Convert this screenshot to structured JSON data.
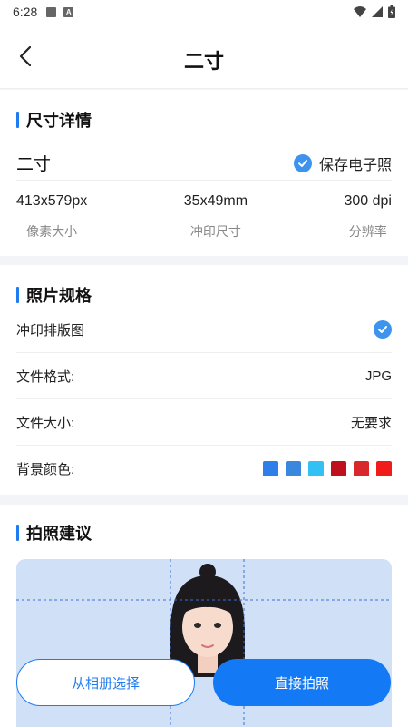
{
  "status_bar": {
    "time": "6:28"
  },
  "nav": {
    "title": "二寸"
  },
  "size_details": {
    "section_title": "尺寸详情",
    "size_name": "二寸",
    "save_option": "保存电子照",
    "specs": [
      {
        "value": "413x579px",
        "label": "像素大小"
      },
      {
        "value": "35x49mm",
        "label": "冲印尺寸"
      },
      {
        "value": "300 dpi",
        "label": "分辨率"
      }
    ]
  },
  "photo_spec": {
    "section_title": "照片规格",
    "print_layout": "冲印排版图",
    "file_format_label": "文件格式:",
    "file_format_value": "JPG",
    "file_size_label": "文件大小:",
    "file_size_value": "无要求",
    "bg_color_label": "背景颜色:",
    "bg_colors": [
      "#2e7fe9",
      "#3a88dd",
      "#33c1f3",
      "#c0101e",
      "#d8282c",
      "#f11b1b"
    ]
  },
  "suggestion": {
    "section_title": "拍照建议"
  },
  "buttons": {
    "album": "从相册选择",
    "shoot": "直接拍照"
  },
  "colors": {
    "accent": "#1e7cf0",
    "check": "#3d93ee"
  }
}
